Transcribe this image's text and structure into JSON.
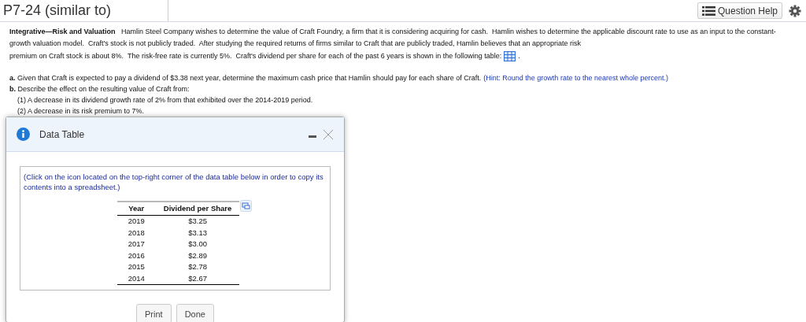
{
  "header": {
    "title": "P7-24 (similar to)",
    "help_button": "Question Help"
  },
  "question": {
    "intro": "**Integrative—Risk and Valuation**   Hamlin Steel Company wishes to determine the value of Craft Foundry, a firm that it is considering acquiring for cash.  Hamlin wishes to determine the applicable discount rate to use as an input to the constant-growth valuation model.  Craft's stock is not publicly traded.  After studying the required returns of firms similar to Craft that are publicly traded, Hamlin believes that an appropriate risk",
    "intro_last_line": "premium on Craft stock is about 8%.  The risk-free rate is currently 5%.  Craft's dividend per share for each of the past 6 years is shown in the following table:",
    "intro_end": ".",
    "part_a": "**a.** Given that Craft is expected to pay a dividend of $3.38 next year, determine the maximum cash price that Hamlin should pay for each share of Craft.",
    "part_a_hint": "(Hint: Round the growth rate to the nearest whole percent.)",
    "part_b": "**b.** Describe the effect on the resulting value of Craft from:",
    "part_b_items": [
      "(1) A decrease in its dividend growth rate of 2% from that exhibited over the 2014-2019 period.",
      "(2) A decrease in its risk premium to 7%."
    ]
  },
  "dialog": {
    "title": "Data Table",
    "instruction": "(Click on the icon located on the top-right corner of the data table below in order to copy its contents into a spreadsheet.)",
    "table": {
      "columns": [
        "Year",
        "Dividend per Share"
      ],
      "rows": [
        [
          "2019",
          "$3.25"
        ],
        [
          "2018",
          "$3.13"
        ],
        [
          "2017",
          "$3.00"
        ],
        [
          "2016",
          "$2.89"
        ],
        [
          "2015",
          "$2.78"
        ],
        [
          "2014",
          "$2.67"
        ]
      ]
    },
    "buttons": [
      "Print",
      "Done"
    ]
  }
}
